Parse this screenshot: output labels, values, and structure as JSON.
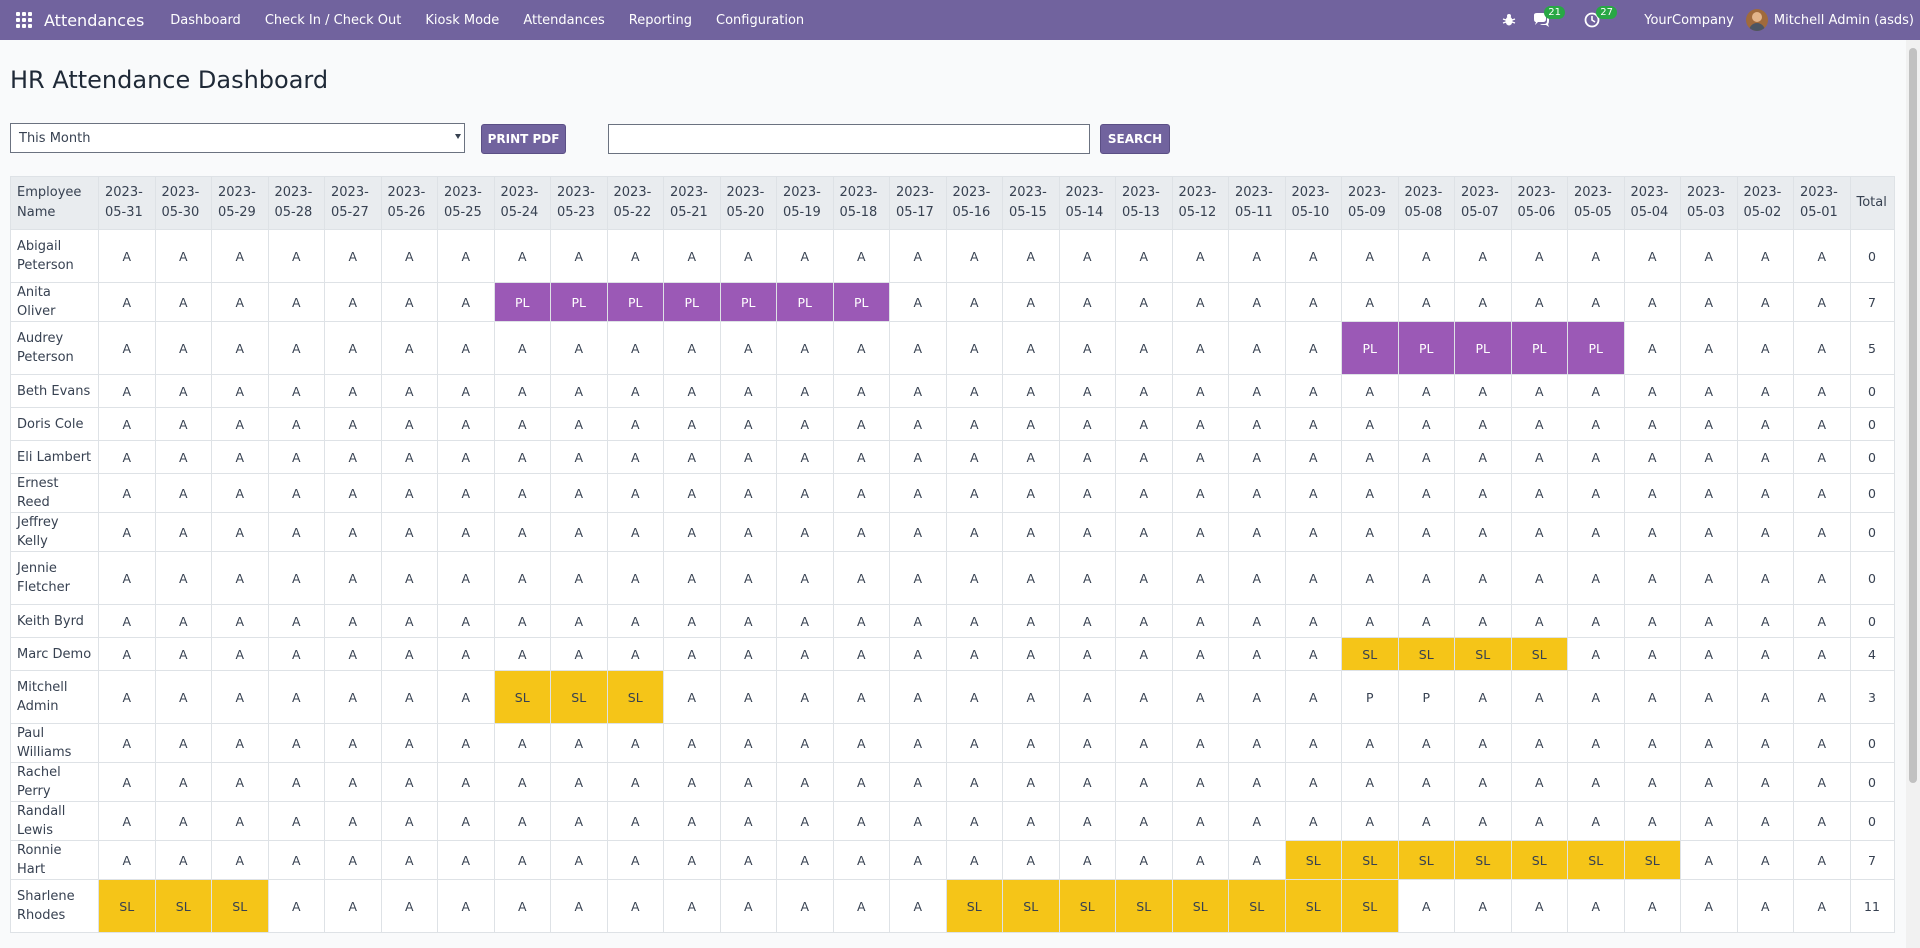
{
  "navbar": {
    "app_name": "Attendances",
    "menu": [
      "Dashboard",
      "Check In / Check Out",
      "Kiosk Mode",
      "Attendances",
      "Reporting",
      "Configuration"
    ],
    "messages_count": "21",
    "activities_count": "27",
    "company": "YourCompany",
    "user": "Mitchell Admin (asds)"
  },
  "page": {
    "title": "HR Attendance Dashboard",
    "period": "This Month",
    "print_label": "PRINT PDF",
    "search_value": "",
    "search_label": "SEARCH"
  },
  "table": {
    "name_header": "Employee Name",
    "total_header": "Total",
    "dates": [
      "2023-05-31",
      "2023-05-30",
      "2023-05-29",
      "2023-05-28",
      "2023-05-27",
      "2023-05-26",
      "2023-05-25",
      "2023-05-24",
      "2023-05-23",
      "2023-05-22",
      "2023-05-21",
      "2023-05-20",
      "2023-05-19",
      "2023-05-18",
      "2023-05-17",
      "2023-05-16",
      "2023-05-15",
      "2023-05-14",
      "2023-05-13",
      "2023-05-12",
      "2023-05-11",
      "2023-05-10",
      "2023-05-09",
      "2023-05-08",
      "2023-05-07",
      "2023-05-06",
      "2023-05-05",
      "2023-05-04",
      "2023-05-03",
      "2023-05-02",
      "2023-05-01"
    ],
    "rows": [
      {
        "name": "Abigail Peterson",
        "cells": [
          "A",
          "A",
          "A",
          "A",
          "A",
          "A",
          "A",
          "A",
          "A",
          "A",
          "A",
          "A",
          "A",
          "A",
          "A",
          "A",
          "A",
          "A",
          "A",
          "A",
          "A",
          "A",
          "A",
          "A",
          "A",
          "A",
          "A",
          "A",
          "A",
          "A",
          "A"
        ],
        "total": "0"
      },
      {
        "name": "Anita Oliver",
        "cells": [
          "A",
          "A",
          "A",
          "A",
          "A",
          "A",
          "A",
          "PL",
          "PL",
          "PL",
          "PL",
          "PL",
          "PL",
          "PL",
          "A",
          "A",
          "A",
          "A",
          "A",
          "A",
          "A",
          "A",
          "A",
          "A",
          "A",
          "A",
          "A",
          "A",
          "A",
          "A",
          "A"
        ],
        "total": "7"
      },
      {
        "name": "Audrey Peterson",
        "cells": [
          "A",
          "A",
          "A",
          "A",
          "A",
          "A",
          "A",
          "A",
          "A",
          "A",
          "A",
          "A",
          "A",
          "A",
          "A",
          "A",
          "A",
          "A",
          "A",
          "A",
          "A",
          "A",
          "PL",
          "PL",
          "PL",
          "PL",
          "PL",
          "A",
          "A",
          "A",
          "A"
        ],
        "total": "5"
      },
      {
        "name": "Beth Evans",
        "cells": [
          "A",
          "A",
          "A",
          "A",
          "A",
          "A",
          "A",
          "A",
          "A",
          "A",
          "A",
          "A",
          "A",
          "A",
          "A",
          "A",
          "A",
          "A",
          "A",
          "A",
          "A",
          "A",
          "A",
          "A",
          "A",
          "A",
          "A",
          "A",
          "A",
          "A",
          "A"
        ],
        "total": "0"
      },
      {
        "name": "Doris Cole",
        "cells": [
          "A",
          "A",
          "A",
          "A",
          "A",
          "A",
          "A",
          "A",
          "A",
          "A",
          "A",
          "A",
          "A",
          "A",
          "A",
          "A",
          "A",
          "A",
          "A",
          "A",
          "A",
          "A",
          "A",
          "A",
          "A",
          "A",
          "A",
          "A",
          "A",
          "A",
          "A"
        ],
        "total": "0"
      },
      {
        "name": "Eli Lambert",
        "cells": [
          "A",
          "A",
          "A",
          "A",
          "A",
          "A",
          "A",
          "A",
          "A",
          "A",
          "A",
          "A",
          "A",
          "A",
          "A",
          "A",
          "A",
          "A",
          "A",
          "A",
          "A",
          "A",
          "A",
          "A",
          "A",
          "A",
          "A",
          "A",
          "A",
          "A",
          "A"
        ],
        "total": "0"
      },
      {
        "name": "Ernest Reed",
        "cells": [
          "A",
          "A",
          "A",
          "A",
          "A",
          "A",
          "A",
          "A",
          "A",
          "A",
          "A",
          "A",
          "A",
          "A",
          "A",
          "A",
          "A",
          "A",
          "A",
          "A",
          "A",
          "A",
          "A",
          "A",
          "A",
          "A",
          "A",
          "A",
          "A",
          "A",
          "A"
        ],
        "total": "0"
      },
      {
        "name": "Jeffrey Kelly",
        "cells": [
          "A",
          "A",
          "A",
          "A",
          "A",
          "A",
          "A",
          "A",
          "A",
          "A",
          "A",
          "A",
          "A",
          "A",
          "A",
          "A",
          "A",
          "A",
          "A",
          "A",
          "A",
          "A",
          "A",
          "A",
          "A",
          "A",
          "A",
          "A",
          "A",
          "A",
          "A"
        ],
        "total": "0"
      },
      {
        "name": "Jennie Fletcher",
        "cells": [
          "A",
          "A",
          "A",
          "A",
          "A",
          "A",
          "A",
          "A",
          "A",
          "A",
          "A",
          "A",
          "A",
          "A",
          "A",
          "A",
          "A",
          "A",
          "A",
          "A",
          "A",
          "A",
          "A",
          "A",
          "A",
          "A",
          "A",
          "A",
          "A",
          "A",
          "A"
        ],
        "total": "0"
      },
      {
        "name": "Keith Byrd",
        "cells": [
          "A",
          "A",
          "A",
          "A",
          "A",
          "A",
          "A",
          "A",
          "A",
          "A",
          "A",
          "A",
          "A",
          "A",
          "A",
          "A",
          "A",
          "A",
          "A",
          "A",
          "A",
          "A",
          "A",
          "A",
          "A",
          "A",
          "A",
          "A",
          "A",
          "A",
          "A"
        ],
        "total": "0"
      },
      {
        "name": "Marc Demo",
        "cells": [
          "A",
          "A",
          "A",
          "A",
          "A",
          "A",
          "A",
          "A",
          "A",
          "A",
          "A",
          "A",
          "A",
          "A",
          "A",
          "A",
          "A",
          "A",
          "A",
          "A",
          "A",
          "A",
          "SL",
          "SL",
          "SL",
          "SL",
          "A",
          "A",
          "A",
          "A",
          "A"
        ],
        "total": "4"
      },
      {
        "name": "Mitchell Admin",
        "cells": [
          "A",
          "A",
          "A",
          "A",
          "A",
          "A",
          "A",
          "SL",
          "SL",
          "SL",
          "A",
          "A",
          "A",
          "A",
          "A",
          "A",
          "A",
          "A",
          "A",
          "A",
          "A",
          "A",
          "P",
          "P",
          "A",
          "A",
          "A",
          "A",
          "A",
          "A",
          "A"
        ],
        "total": "3"
      },
      {
        "name": "Paul Williams",
        "cells": [
          "A",
          "A",
          "A",
          "A",
          "A",
          "A",
          "A",
          "A",
          "A",
          "A",
          "A",
          "A",
          "A",
          "A",
          "A",
          "A",
          "A",
          "A",
          "A",
          "A",
          "A",
          "A",
          "A",
          "A",
          "A",
          "A",
          "A",
          "A",
          "A",
          "A",
          "A"
        ],
        "total": "0"
      },
      {
        "name": "Rachel Perry",
        "cells": [
          "A",
          "A",
          "A",
          "A",
          "A",
          "A",
          "A",
          "A",
          "A",
          "A",
          "A",
          "A",
          "A",
          "A",
          "A",
          "A",
          "A",
          "A",
          "A",
          "A",
          "A",
          "A",
          "A",
          "A",
          "A",
          "A",
          "A",
          "A",
          "A",
          "A",
          "A"
        ],
        "total": "0"
      },
      {
        "name": "Randall Lewis",
        "cells": [
          "A",
          "A",
          "A",
          "A",
          "A",
          "A",
          "A",
          "A",
          "A",
          "A",
          "A",
          "A",
          "A",
          "A",
          "A",
          "A",
          "A",
          "A",
          "A",
          "A",
          "A",
          "A",
          "A",
          "A",
          "A",
          "A",
          "A",
          "A",
          "A",
          "A",
          "A"
        ],
        "total": "0"
      },
      {
        "name": "Ronnie Hart",
        "cells": [
          "A",
          "A",
          "A",
          "A",
          "A",
          "A",
          "A",
          "A",
          "A",
          "A",
          "A",
          "A",
          "A",
          "A",
          "A",
          "A",
          "A",
          "A",
          "A",
          "A",
          "A",
          "SL",
          "SL",
          "SL",
          "SL",
          "SL",
          "SL",
          "SL",
          "A",
          "A",
          "A"
        ],
        "total": "7"
      },
      {
        "name": "Sharlene Rhodes",
        "cells": [
          "SL",
          "SL",
          "SL",
          "A",
          "A",
          "A",
          "A",
          "A",
          "A",
          "A",
          "A",
          "A",
          "A",
          "A",
          "A",
          "SL",
          "SL",
          "SL",
          "SL",
          "SL",
          "SL",
          "SL",
          "SL",
          "A",
          "A",
          "A",
          "A",
          "A",
          "A",
          "A",
          "A"
        ],
        "total": "11"
      }
    ]
  },
  "colors": {
    "navbar": "#71639e",
    "paid_leave": "#9b59b6",
    "sick_leave": "#f5c518"
  }
}
